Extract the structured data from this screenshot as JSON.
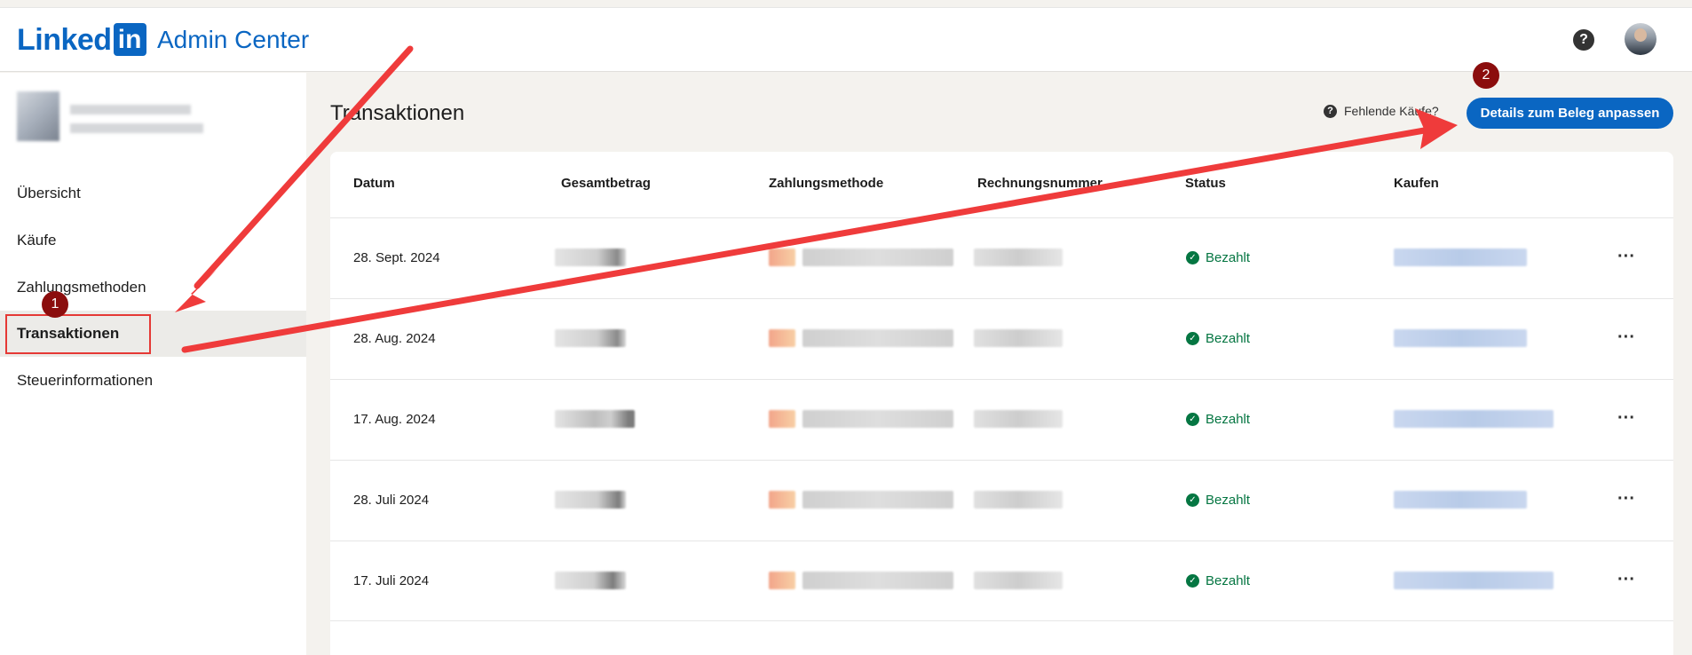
{
  "header": {
    "logo_text": "Linked",
    "logo_box": "in",
    "app_name": "Admin Center",
    "help_glyph": "?",
    "icons": [
      "help-icon",
      "avatar"
    ]
  },
  "sidebar": {
    "items": [
      {
        "label": "Übersicht"
      },
      {
        "label": "Käufe"
      },
      {
        "label": "Zahlungsmethoden"
      },
      {
        "label": "Transaktionen",
        "active": true
      },
      {
        "label": "Steuerinformationen"
      }
    ]
  },
  "main": {
    "title": "Transaktionen",
    "missing_link": "Fehlende Käufe?",
    "missing_glyph": "?",
    "primary_button": "Details zum Beleg anpassen",
    "table": {
      "headers": [
        "Datum",
        "Gesamtbetrag",
        "Zahlungsmethode",
        "Rechnungsnummer",
        "Status",
        "Kaufen"
      ],
      "rows": [
        {
          "date": "28. Sept. 2024",
          "status": "Bezahlt",
          "more": "···"
        },
        {
          "date": "28. Aug. 2024",
          "status": "Bezahlt",
          "more": "···"
        },
        {
          "date": "17. Aug. 2024",
          "status": "Bezahlt",
          "more": "···"
        },
        {
          "date": "28. Juli 2024",
          "status": "Bezahlt",
          "more": "···"
        },
        {
          "date": "17. Juli 2024",
          "status": "Bezahlt",
          "more": "···"
        }
      ]
    }
  },
  "annotations": {
    "badge_1": "1",
    "badge_2": "2"
  },
  "colors": {
    "brand": "#0a66c2",
    "status_green": "#057642",
    "annotation_red": "#e53935",
    "badge": "#8b0d0d"
  }
}
